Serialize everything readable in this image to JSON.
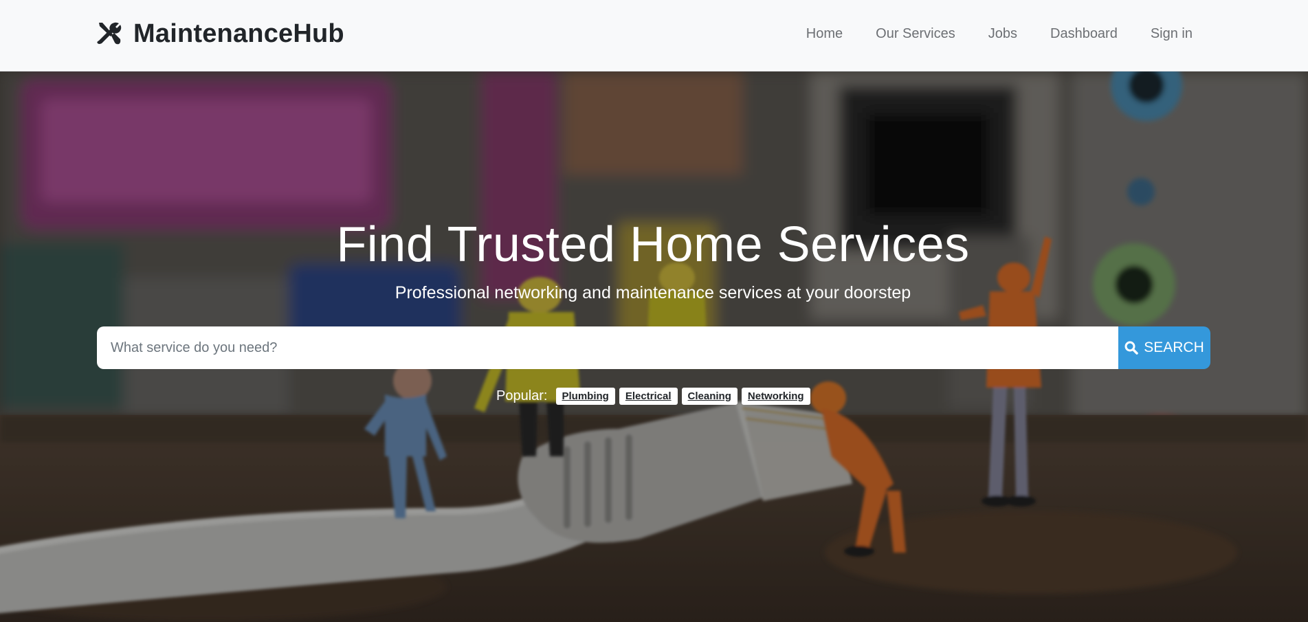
{
  "brand": {
    "name": "MaintenanceHub",
    "icon": "tools-icon"
  },
  "nav": {
    "items": [
      {
        "label": "Home"
      },
      {
        "label": "Our Services"
      },
      {
        "label": "Jobs"
      },
      {
        "label": "Dashboard"
      },
      {
        "label": "Sign in"
      }
    ]
  },
  "hero": {
    "title": "Find Trusted Home Services",
    "subtitle": "Professional networking and maintenance services at your doorstep",
    "search": {
      "placeholder": "What service do you need?",
      "value": "",
      "button_label": "SEARCH",
      "button_icon": "search-icon"
    },
    "popular": {
      "label": "Popular:",
      "tags": [
        "Plumbing",
        "Electrical",
        "Cleaning",
        "Networking"
      ]
    }
  },
  "colors": {
    "navbar_bg": "#f8f9fa",
    "brand_text": "#212529",
    "nav_link": "#6c6f73",
    "accent": "#3498db",
    "hero_text": "#ffffff"
  }
}
